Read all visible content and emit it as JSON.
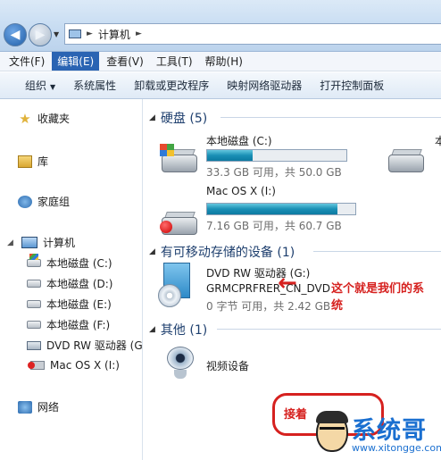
{
  "address": {
    "path": "计算机"
  },
  "menu": [
    "文件(F)",
    "编辑(E)",
    "查看(V)",
    "工具(T)",
    "帮助(H)"
  ],
  "menu_active_index": 1,
  "toolbar": {
    "organize": "组织",
    "items": [
      "系统属性",
      "卸载或更改程序",
      "映射网络驱动器",
      "打开控制面板"
    ]
  },
  "nav": {
    "favorites": "收藏夹",
    "libraries": "库",
    "homegroup": "家庭组",
    "computer": "计算机",
    "drives": [
      "本地磁盘 (C:)",
      "本地磁盘 (D:)",
      "本地磁盘 (E:)",
      "本地磁盘 (F:)",
      "DVD RW 驱动器 (G",
      "Mac OS X (I:)"
    ],
    "network": "网络"
  },
  "content": {
    "hard_disks": {
      "header": "硬盘 (5)",
      "items": [
        {
          "name": "本地磁盘 (C:)",
          "info": "33.3 GB 可用，共 50.0 GB",
          "used_fraction": 0.33
        },
        {
          "name": "Mac OS X (I:)",
          "info": "7.16 GB 可用，共 60.7 GB",
          "used_fraction": 0.88
        }
      ],
      "cutoff_label": "本"
    },
    "removable": {
      "header": "有可移动存储的设备 (1)",
      "name": "DVD RW 驱动器 (G:)",
      "label": "GRMCPRFRER_CN_DVD",
      "info": "0 字节 可用，共 2.42 GB"
    },
    "other": {
      "header": "其他 (1)",
      "device": "视频设备"
    }
  },
  "annotations": {
    "note_line1": "这个就是我们的系",
    "note_line2": "统",
    "bottom_note": "接着"
  },
  "logo": {
    "brand": "系统哥",
    "url": "www.xitongge.com"
  },
  "colors": {
    "accent": "#2a64b3",
    "annotation": "#d6211f",
    "brand": "#1a6fd0",
    "bar_fill": "#1a8fb5"
  }
}
